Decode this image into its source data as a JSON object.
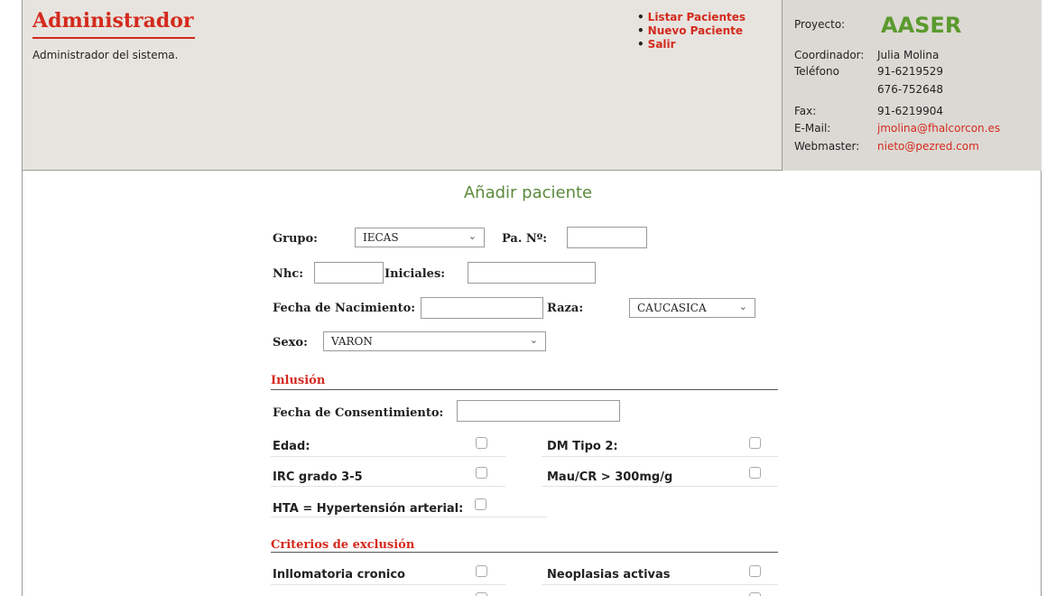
{
  "header": {
    "title": "Administrador",
    "subtitle": "Administrador del sistema.",
    "nav": [
      "Listar Pacientes",
      "Nuevo Paciente",
      "Salir"
    ]
  },
  "info": {
    "proyecto_label": "Proyecto:",
    "proyecto_value": "AASER",
    "coordinador_label": "Coordinador:",
    "coordinador_value": "Julia Molina",
    "telefono_label": "Teléfono",
    "telefono_value_1": "91-6219529",
    "telefono_value_2": "676-752648",
    "fax_label": "Fax:",
    "fax_value": "91-6219904",
    "email_label": "E-Mail:",
    "email_value": "jmolina@fhalcorcon.es",
    "webmaster_label": "Webmaster:",
    "webmaster_value": "nieto@pezred.com"
  },
  "form": {
    "title": "Añadir paciente",
    "grupo_label": "Grupo:",
    "grupo_value": "IECAS",
    "pa_label": "Pa. Nº:",
    "nhc_label": "Nhc:",
    "iniciales_label": "Iniciales:",
    "fecha_nac_label": "Fecha de Nacimiento:",
    "raza_label": "Raza:",
    "raza_value": "CAUCASICA",
    "sexo_label": "Sexo:",
    "sexo_value": "VARON",
    "inclusion_heading": "Inlusión",
    "fecha_consent_label": "Fecha de Consentimiento:",
    "edad_label": "Edad:",
    "dm_label": "DM Tipo 2:",
    "irc_label": "IRC grado 3-5",
    "mau_label": "Mau/CR > 300mg/g",
    "hta_label": "HTA = Hypertensión arterial:",
    "exclusion_heading": "Criterios de exclusión",
    "inflam_label": "Inllomatoria cronico",
    "neo_label": "Neoplasias activas"
  },
  "colors": {
    "accent_red": "#d42a1e",
    "accent_green": "#5a9a2e",
    "header_bg": "#e7e4df"
  }
}
